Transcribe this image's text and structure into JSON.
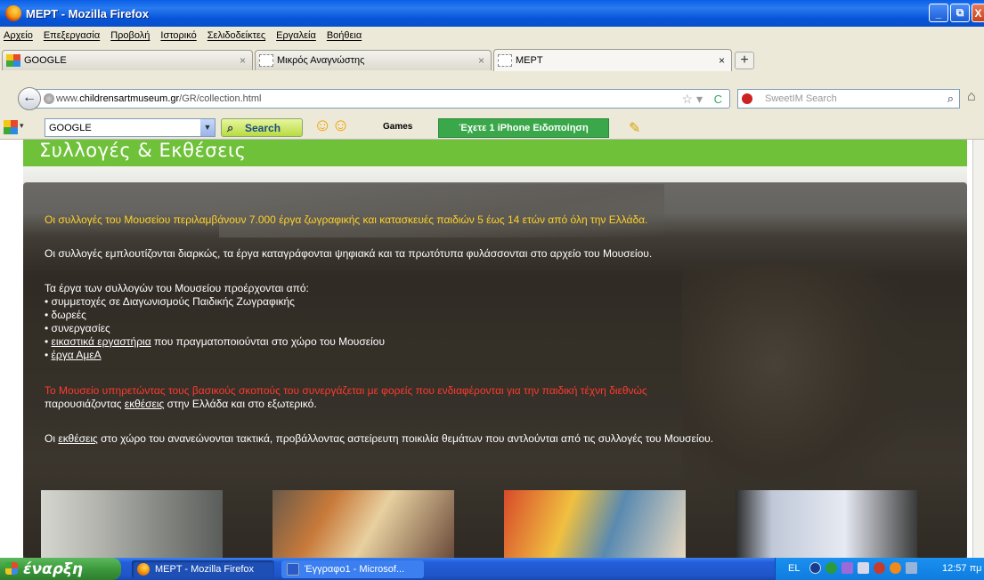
{
  "window": {
    "title": "ΜΕΡΤ - Mozilla Firefox",
    "buttons": {
      "minimize": "_",
      "maximize": "⧉",
      "close": "X"
    }
  },
  "menu": [
    "Αρχείο",
    "Επεξεργασία",
    "Προβολή",
    "Ιστορικό",
    "Σελιδοδείκτες",
    "Εργαλεία",
    "Βοήθεια"
  ],
  "tabs": [
    {
      "label": "GOOGLE",
      "close": "×"
    },
    {
      "label": "Μικρός Αναγνώστης",
      "close": "×"
    },
    {
      "label": "ΜΕΡΤ",
      "close": "×"
    }
  ],
  "new_tab": "+",
  "nav": {
    "back": "←",
    "url_prefix": "www.",
    "url_domain": "childrensartmuseum.gr",
    "url_path": "/GR/collection.html",
    "star": "☆ ▾",
    "reload": "C",
    "search_placeholder": "SweetIM Search",
    "search_icon": "⌕",
    "home": "⌂"
  },
  "toolbar": {
    "engine_select": "GOOGLE",
    "search_button": "Search",
    "games": "Games",
    "notification": "Έχετε 1 iPhone Ειδοποίηση"
  },
  "page": {
    "header_title": "Συλλογές & Εκθέσεις",
    "p1": "Οι συλλογές του Μουσείου περιλαμβάνουν 7.000 έργα ζωγραφικής και κατασκευές παιδιών 5 έως 14 ετών από όλη την Ελλάδα.",
    "p2": "Οι συλλογές εμπλουτίζονται διαρκώς, τα έργα καταγράφονται ψηφιακά και τα πρωτότυπα φυλάσσονται στο αρχείο του Μουσείου.",
    "p3_intro": "Τα έργα των συλλογών του Μουσείου προέρχονται από:",
    "list": {
      "item1": "• συμμετοχές σε Διαγωνισμούς Παιδικής Ζωγραφικής",
      "item2": "• δωρεές",
      "item3": "• συνεργασίες",
      "item4_bullet": "• ",
      "item4_link": "εικαστικά εργαστήρια",
      "item4_rest": " που πραγματοποιούνται στο χώρο του Μουσείου",
      "item5_bullet": "• ",
      "item5_link": "έργα ΑμεΑ"
    },
    "p4_red": "Το Μουσείο υπηρετώντας τους βασικούς σκοπούς του συνεργάζεται με φορείς που ενδιαφέρονται για την παιδική τέχνη διεθνώς",
    "p4_pre": "παρουσιάζοντας ",
    "p4_link": "εκθέσεις",
    "p4_post": " στην Ελλάδα και στο εξωτερικό.",
    "p5_pre": "Οι ",
    "p5_link": "εκθέσεις",
    "p5_post": " στο χώρο του ανανεώνονται τακτικά, προβάλλοντας αστείρευτη ποικιλία θεμάτων που αντλούνται από τις συλλογές του Μουσείου."
  },
  "taskbar": {
    "start": "έναρξη",
    "tasks": [
      "ΜΕΡΤ - Mozilla Firefox",
      "Έγγραφο1 - Microsof..."
    ],
    "lang": "EL",
    "clock": "12:57 πμ"
  },
  "colors": {
    "header_green": "#6fc13a",
    "yellow_text": "#ffd227",
    "red_text": "#ff3a2e",
    "notify_green": "#3aa84a"
  }
}
